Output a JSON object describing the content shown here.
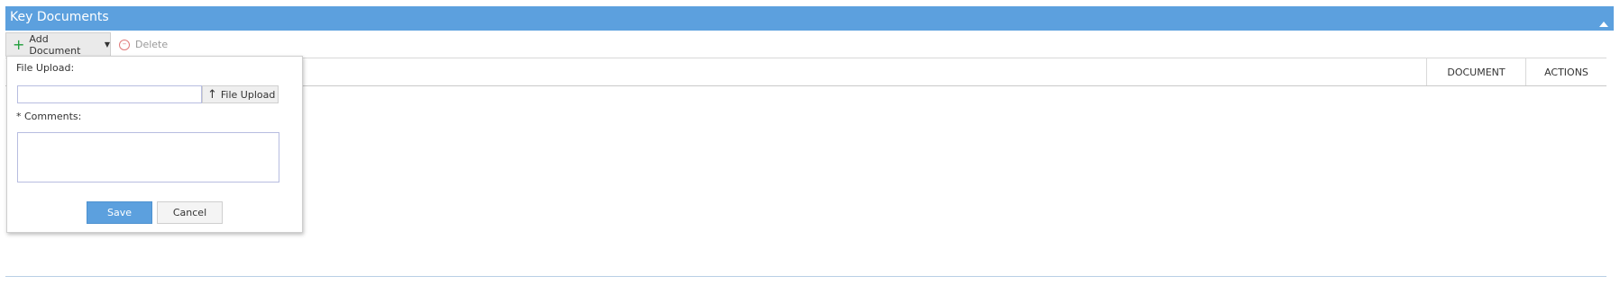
{
  "panel": {
    "title": "Key Documents"
  },
  "toolbar": {
    "add_document_label": "Add Document",
    "delete_label": "Delete"
  },
  "grid": {
    "columns": [
      "",
      "DOCUMENT",
      "ACTIONS"
    ]
  },
  "popup": {
    "file_upload_label": "File Upload:",
    "file_upload_button": "File Upload",
    "file_input_value": "",
    "comments_label": "* Comments:",
    "comments_value": "",
    "save_label": "Save",
    "cancel_label": "Cancel"
  },
  "icons": {
    "collapse": "chevron-up-icon",
    "add": "plus-icon",
    "caret": "caret-down-icon",
    "delete": "minus-circle-icon",
    "upload": "arrow-up-icon"
  },
  "colors": {
    "header": "#5ca0de",
    "add_icon": "#1f9d3a",
    "delete_icon": "#e07b7b"
  }
}
